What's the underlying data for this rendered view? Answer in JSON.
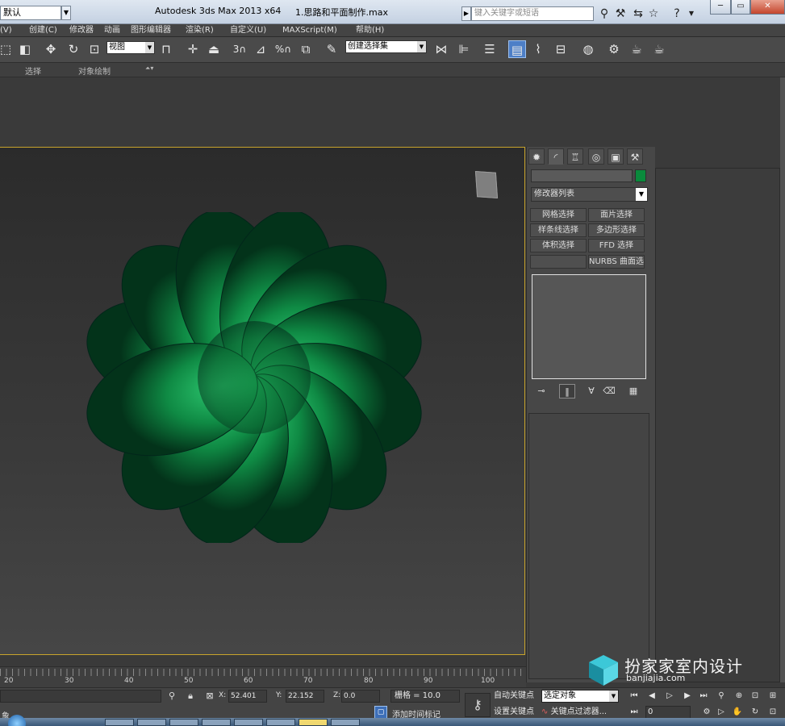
{
  "titlebar": {
    "workspace": "默认",
    "app_title": "Autodesk 3ds Max  2013 x64",
    "file_title": "1.思路和平面制作.max",
    "search_placeholder": "键入关键字或短语"
  },
  "menu": {
    "items": [
      "(V)",
      "创建(C)",
      "修改器",
      "动画",
      "图形编辑器",
      "渲染(R)",
      "自定义(U)",
      "MAXScript(M)",
      "帮助(H)"
    ]
  },
  "toolbar": {
    "reference_coord": "视图",
    "selection_set": "创建选择集",
    "snap_3": "3",
    "snap_percent": "%"
  },
  "ribbon": {
    "tabs": [
      "选择",
      "对象绘制"
    ]
  },
  "viewport": {
    "object_color": "#0a8a3c",
    "border_color": "#c8a42c",
    "petals": 12
  },
  "command_panel": {
    "modifier_list": "修改器列表",
    "buttons": [
      "网格选择",
      "面片选择",
      "样条线选择",
      "多边形选择",
      "体积选择",
      "FFD 选择",
      "",
      "NURBS 曲面选择"
    ],
    "object_color": "#0a8a3c"
  },
  "timeline": {
    "ticks": [
      "20",
      "30",
      "40",
      "50",
      "60",
      "70",
      "80",
      "90",
      "100"
    ]
  },
  "status": {
    "x_label": "X:",
    "x_value": "52.401",
    "y_label": "Y:",
    "y_value": "22.152",
    "z_label": "Z:",
    "z_value": "0.0",
    "grid": "栅格 = 10.0",
    "add_time_tag": "添加时间标记",
    "auto_key": "自动关键点",
    "set_key": "设置关键点",
    "key_mode": "选定对象",
    "key_filters": "关键点过滤器...",
    "frame": "0",
    "status_text": "象"
  },
  "watermark": {
    "name": "扮家家室内设计",
    "url": "banjiajia.com"
  }
}
